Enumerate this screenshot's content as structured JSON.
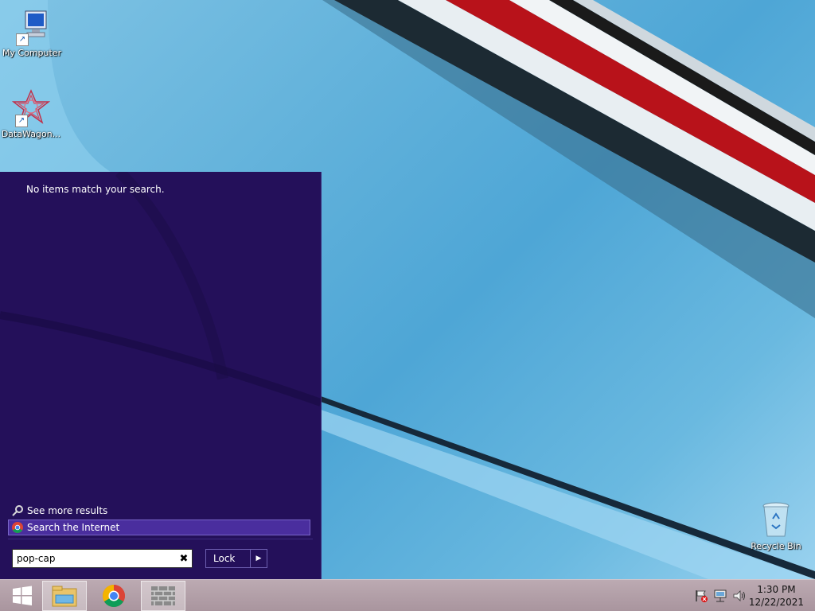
{
  "desktop": {
    "icons": [
      {
        "label": "My Computer"
      },
      {
        "label": "DataWagon..."
      },
      {
        "label": "Recycle Bin"
      }
    ]
  },
  "start_menu": {
    "no_items_text": "No items match your search.",
    "see_more_label": "See more results",
    "search_internet_label": "Search the Internet",
    "search_value": "pop-cap",
    "lock_label": "Lock",
    "clear_glyph": "✖",
    "arrow_glyph": "▶"
  },
  "taskbar": {
    "apps": [
      "start",
      "file-explorer",
      "chrome",
      "wall-app"
    ],
    "clock": {
      "time": "1:30 PM",
      "date": "12/22/2021"
    }
  },
  "colors": {
    "start_menu_bg": "#24105a",
    "highlight": "#4a2e9e",
    "taskbar_bg": "#b3a1a9"
  }
}
